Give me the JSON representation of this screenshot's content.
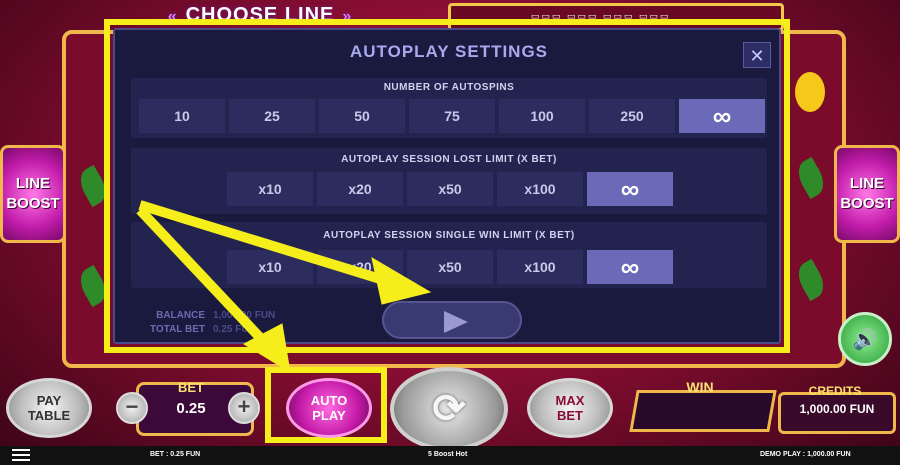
{
  "header": {
    "choose_line": "CHOOSE LINE",
    "chev_left": "«",
    "chev_right": "»"
  },
  "line_boost": {
    "label_line": "LINE",
    "label_boost": "BOOST"
  },
  "dialog": {
    "title": "AUTOPLAY SETTINGS",
    "close": "✕",
    "autospins": {
      "label": "NUMBER OF AUTOSPINS",
      "options": [
        "10",
        "25",
        "50",
        "75",
        "100",
        "250",
        "∞"
      ],
      "selected": "∞"
    },
    "lost_limit": {
      "label": "AUTOPLAY SESSION LOST LIMIT (X BET)",
      "options": [
        "x10",
        "x20",
        "x50",
        "x100",
        "∞"
      ],
      "selected": "∞"
    },
    "win_limit": {
      "label": "AUTOPLAY SESSION SINGLE WIN LIMIT (X BET)",
      "options": [
        "x10",
        "x20",
        "x50",
        "x100",
        "∞"
      ],
      "selected": "∞"
    },
    "balance_label": "BALANCE",
    "balance_value": "1,000.00 FUN",
    "total_bet_label": "TOTAL BET",
    "total_bet_value": "0.25 FUN"
  },
  "controls": {
    "pay_table": [
      "PAY",
      "TABLE"
    ],
    "bet_label": "BET",
    "bet_value": "0.25",
    "minus": "−",
    "plus": "+",
    "auto_play": [
      "AUTO",
      "PLAY"
    ],
    "spin": "⟳",
    "max_bet": [
      "MAX",
      "BET"
    ],
    "win_label": "WIN",
    "credits_label": "CREDITS",
    "credits_value": "1,000.00 FUN",
    "sound": "🔊"
  },
  "status": {
    "bet": "BET : 0.25 FUN",
    "game": "5 Boost Hot",
    "demo": "DEMO PLAY : 1,000.00 FUN"
  },
  "colors": {
    "highlight": "#f6ee1a",
    "dialog_bg": "#1a1a3e",
    "selected_option": "#6a6ab8"
  }
}
